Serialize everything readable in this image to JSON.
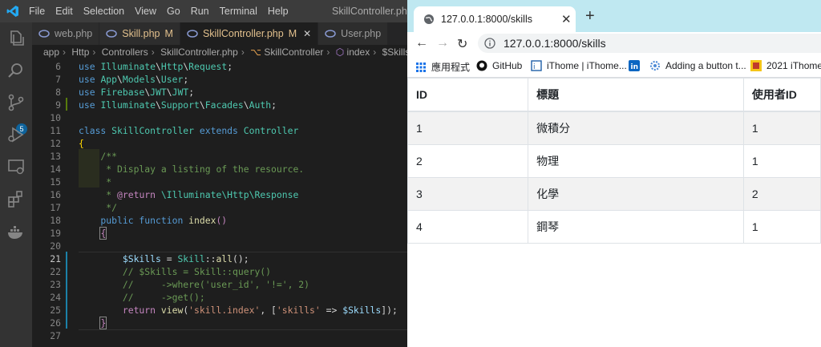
{
  "vscode": {
    "menu": [
      "File",
      "Edit",
      "Selection",
      "View",
      "Go",
      "Run",
      "Terminal",
      "Help"
    ],
    "window_title": "SkillController.php -",
    "tabs": [
      {
        "label": "web.php",
        "modified": ""
      },
      {
        "label": "Skill.php",
        "modified": "M"
      },
      {
        "label": "SkillController.php",
        "modified": "M"
      },
      {
        "label": "User.php",
        "modified": ""
      }
    ],
    "scm_badge": "5",
    "breadcrumb": [
      "app",
      "Http",
      "Controllers",
      "SkillController.php",
      "SkillController",
      "index",
      "$Skills"
    ],
    "line_numbers": [
      "6",
      "7",
      "8",
      "9",
      "10",
      "11",
      "12",
      "13",
      "14",
      "15",
      "16",
      "17",
      "18",
      "19",
      "20",
      "21",
      "22",
      "23",
      "24",
      "25",
      "26",
      "27"
    ]
  },
  "browser": {
    "tab_title": "127.0.0.1:8000/skills",
    "url": "127.0.0.1:8000/skills",
    "bookmarks": [
      "應用程式",
      "GitHub",
      "iThome | iThome...",
      "Adding a button t...",
      "2021 iThome"
    ],
    "table": {
      "headers": [
        "ID",
        "標題",
        "使用者ID"
      ],
      "rows": [
        [
          "1",
          "微積分",
          "1"
        ],
        [
          "2",
          "物理",
          "1"
        ],
        [
          "3",
          "化學",
          "2"
        ],
        [
          "4",
          "鋼琴",
          "1"
        ]
      ]
    }
  }
}
